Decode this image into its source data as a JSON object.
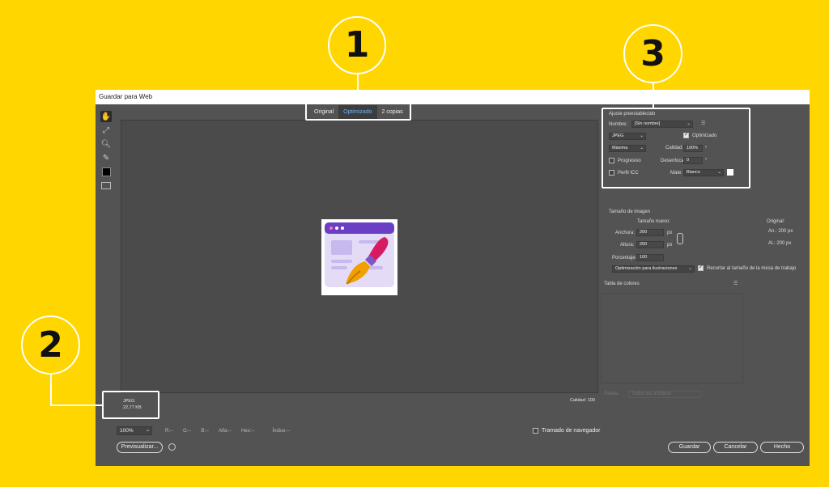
{
  "window": {
    "title": "Guardar para Web"
  },
  "tabs": [
    {
      "label": "Original"
    },
    {
      "label": "Optimizado"
    },
    {
      "label": "2 copias"
    }
  ],
  "image_info": {
    "format": "JPEG",
    "size": "22,77 KB",
    "quality": "Calidad: 100"
  },
  "bottom": {
    "zoom": "100%",
    "readouts": [
      "R:--",
      "G:--",
      "B:--",
      "Alfa:--",
      "Hex:--",
      "Índice:--"
    ],
    "dither_label": "Tramado de navegador",
    "preview_label": "Previsualizar...",
    "save": "Guardar",
    "cancel": "Cancelar",
    "done": "Hecho"
  },
  "preset": {
    "heading": "Ajuste preestablecido",
    "name_label": "Nombre:",
    "name_value": "[Sin nombre]",
    "format": "JPEG",
    "optimized_label": "Optimizado",
    "optimized_checked": true,
    "quality_level": "Máxima",
    "quality_label": "Calidad:",
    "quality_value": "100%",
    "progressive_label": "Progresivo",
    "blur_label": "Desenfocar:",
    "blur_value": "0",
    "icc_label": "Perfil ICC",
    "matte_label": "Mate:",
    "matte_value": "Blanco"
  },
  "image_size": {
    "heading": "Tamaño de imagen",
    "new_size_label": "Tamaño nuevo:",
    "original_label": "Original:",
    "width_label": "Anchura:",
    "width_value": "200",
    "height_label": "Altura:",
    "height_value": "200",
    "unit": "px",
    "percent_label": "Porcentaje:",
    "percent_value": "100",
    "orig_width": "An.:  200 px",
    "orig_height": "Al.:  200 px",
    "resample": "Optimización para ilustraciones",
    "clip_label": "Recortar al tamaño de la mesa de trabajo"
  },
  "color_table": {
    "heading": "Tabla de colores",
    "palette_label": "Paleta:",
    "palette_value": "Todos los archivos"
  },
  "callouts": [
    "1",
    "2",
    "3"
  ],
  "colors": {
    "background": "#ffd600",
    "dialog": "#535353",
    "canvas": "#4b4b4b",
    "accent": "#6ab4ff"
  }
}
